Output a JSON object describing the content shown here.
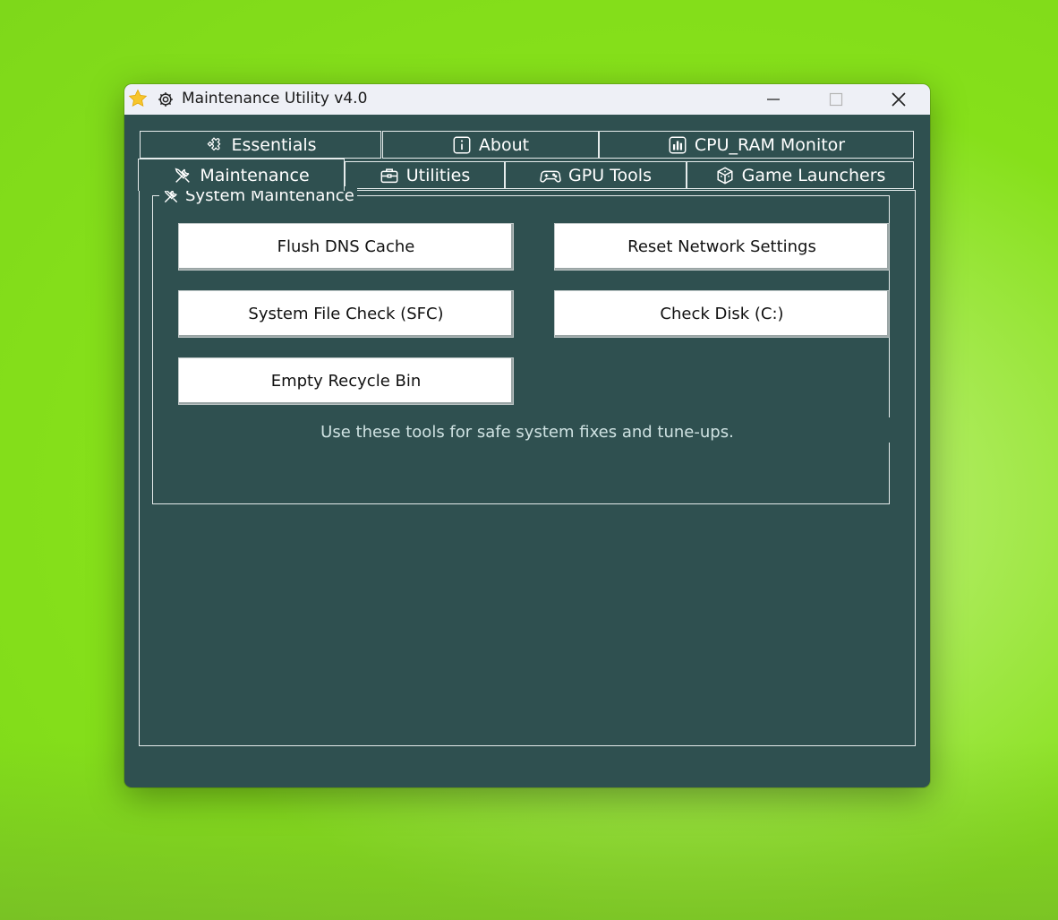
{
  "window": {
    "title": "Maintenance Utility v4.0",
    "controls": {
      "minimize_icon": "minimize-icon",
      "maximize_icon": "maximize-icon",
      "close_icon": "close-icon"
    }
  },
  "tabs": {
    "row1": [
      {
        "label": "Essentials",
        "icon": "puzzle-icon"
      },
      {
        "label": "About",
        "icon": "info-icon"
      },
      {
        "label": "CPU_RAM Monitor",
        "icon": "bar-chart-icon"
      }
    ],
    "row2": [
      {
        "label": "Maintenance",
        "icon": "tools-icon",
        "active": true
      },
      {
        "label": "Utilities",
        "icon": "toolbox-icon"
      },
      {
        "label": "GPU Tools",
        "icon": "gamepad-icon"
      },
      {
        "label": "Game Launchers",
        "icon": "dice-icon"
      }
    ]
  },
  "group": {
    "title": "System Maintenance",
    "buttons": {
      "flush_dns": "Flush DNS Cache",
      "reset_network": "Reset Network Settings",
      "sfc": "System File Check (SFC)",
      "check_disk": "Check Disk (C:)",
      "empty_bin": "Empty Recycle Bin"
    },
    "hint": "Use these tools for safe system fixes and tune-ups."
  },
  "colors": {
    "window_bg": "#2f5050",
    "titlebar_bg": "#eef0f6",
    "border": "#e6ecec",
    "hint_text": "#cfe2e2"
  }
}
